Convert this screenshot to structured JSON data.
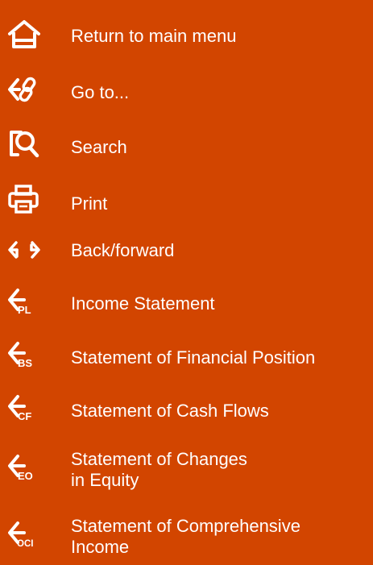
{
  "menu": {
    "items": [
      {
        "label": "Return to main menu",
        "icon": "home-icon"
      },
      {
        "label": "Go to...",
        "icon": "goto-link-icon"
      },
      {
        "label": "Search",
        "icon": "search-icon"
      },
      {
        "label": "Print",
        "icon": "print-icon"
      },
      {
        "label": "Back/forward",
        "icon": "back-forward-icon"
      },
      {
        "label": "Income Statement",
        "icon": "back-pl-icon",
        "badge": "PL"
      },
      {
        "label": "Statement of Financial Position",
        "icon": "back-bs-icon",
        "badge": "BS"
      },
      {
        "label": "Statement of Cash Flows",
        "icon": "back-cf-icon",
        "badge": "CF"
      },
      {
        "label": "Statement of Changes in Equity",
        "icon": "back-eo-icon",
        "badge": "EO",
        "line1": "Statement of Changes",
        "line2": "in Equity"
      },
      {
        "label": "Statement of Comprehensive Income",
        "icon": "back-oci-icon",
        "badge": "OCI",
        "line1": "Statement of Comprehensive",
        "line2": "Income"
      }
    ]
  },
  "colors": {
    "background": "#D24500",
    "foreground": "#FFFFFF"
  }
}
